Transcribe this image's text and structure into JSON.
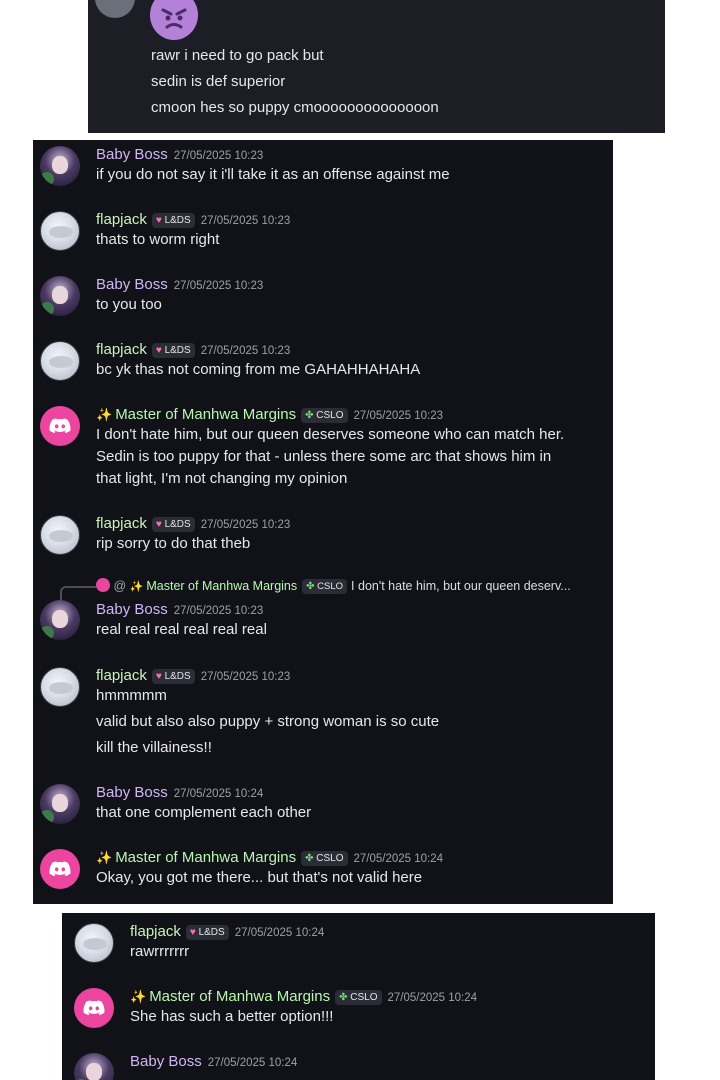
{
  "panel1": {
    "lines": [
      "rawr i need to go pack but",
      "sedin is def superior",
      "cmoon hes so puppy cmoooooooooooooon"
    ]
  },
  "panel2": {
    "messages": [
      {
        "author": "Baby Boss",
        "time": "27/05/2025 10:23",
        "lines": [
          "if you do not say it i'll take it as an offense against me"
        ]
      },
      {
        "author": "flapjack",
        "badge": "L&DS",
        "time": "27/05/2025 10:23",
        "lines": [
          "thats to worm right"
        ]
      },
      {
        "author": "Baby Boss",
        "time": "27/05/2025 10:23",
        "lines": [
          "to you too"
        ]
      },
      {
        "author": "flapjack",
        "badge": "L&DS",
        "time": "27/05/2025 10:23",
        "lines": [
          "bc yk thas not coming from me GAHAHHAHAHA"
        ]
      },
      {
        "author": "Master of Manhwa Margins",
        "badge": "CSLO",
        "time": "27/05/2025 10:23",
        "lines": [
          "I don't hate him, but our queen deserves someone who can match her.",
          "Sedin is too puppy for that  - unless there some arc that shows him in",
          "that light, I'm not changing my opinion"
        ]
      },
      {
        "author": "flapjack",
        "badge": "L&DS",
        "time": "27/05/2025 10:23",
        "lines": [
          "rip sorry to do that theb"
        ]
      },
      {
        "reply_prefix": "@",
        "reply_author": "Master of Manhwa Margins",
        "reply_badge": "CSLO",
        "reply_text": "I don't hate him, but our queen deserv...",
        "author": "Baby Boss",
        "time": "27/05/2025 10:23",
        "lines": [
          "real real real real real real"
        ]
      },
      {
        "author": "flapjack",
        "badge": "L&DS",
        "time": "27/05/2025 10:23",
        "lines": [
          "hmmmmm",
          "valid but also also puppy + strong woman is so cute",
          "kill the villainess!!"
        ]
      },
      {
        "author": "Baby Boss",
        "time": "27/05/2025 10:24",
        "lines": [
          "that one complement each other"
        ]
      },
      {
        "author": "Master of Manhwa Margins",
        "badge": "CSLO",
        "time": "27/05/2025 10:24",
        "lines": [
          "Okay, you got me there... but that's not valid here"
        ]
      }
    ]
  },
  "panel3": {
    "messages": [
      {
        "author": "flapjack",
        "badge": "L&DS",
        "time": "27/05/2025 10:24",
        "lines": [
          "rawrrrrrrr"
        ]
      },
      {
        "author": "Master of Manhwa Margins",
        "badge": "CSLO",
        "time": "27/05/2025 10:24",
        "lines": [
          "She has such a better option!!!"
        ]
      },
      {
        "author": "Baby Boss",
        "time": "27/05/2025 10:24",
        "lines": []
      }
    ]
  }
}
